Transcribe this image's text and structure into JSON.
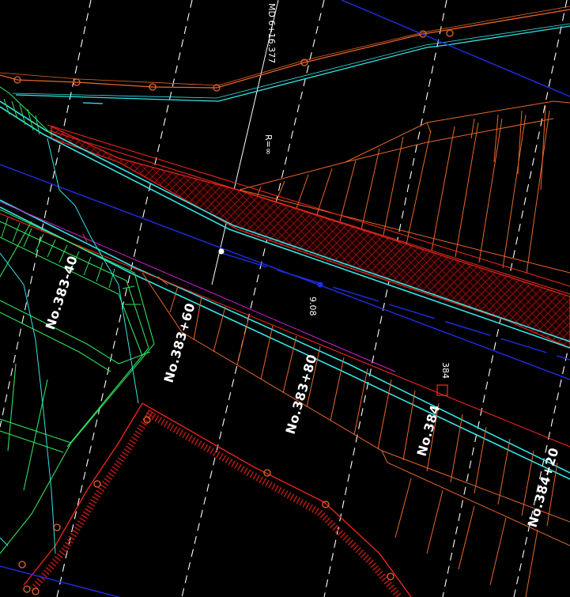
{
  "colors": {
    "background": "#000000",
    "orange": "#e8662a",
    "cyan": "#35e3e3",
    "blue": "#1f2ee6",
    "red": "#e8251c",
    "hatch_red": "#b81a14",
    "green": "#2fe05a",
    "white": "#ffffff",
    "magenta": "#d020d0"
  },
  "stations": [
    {
      "label": "No.383-40"
    },
    {
      "label": "No.383+60"
    },
    {
      "label": "No.383+80"
    },
    {
      "label": "No.384"
    },
    {
      "label": "No.384+20"
    }
  ],
  "annotations": {
    "top_code": "MD 6+16.377",
    "radius": "R=∞",
    "mid_tag": "9.08",
    "sta_tag": "384"
  }
}
